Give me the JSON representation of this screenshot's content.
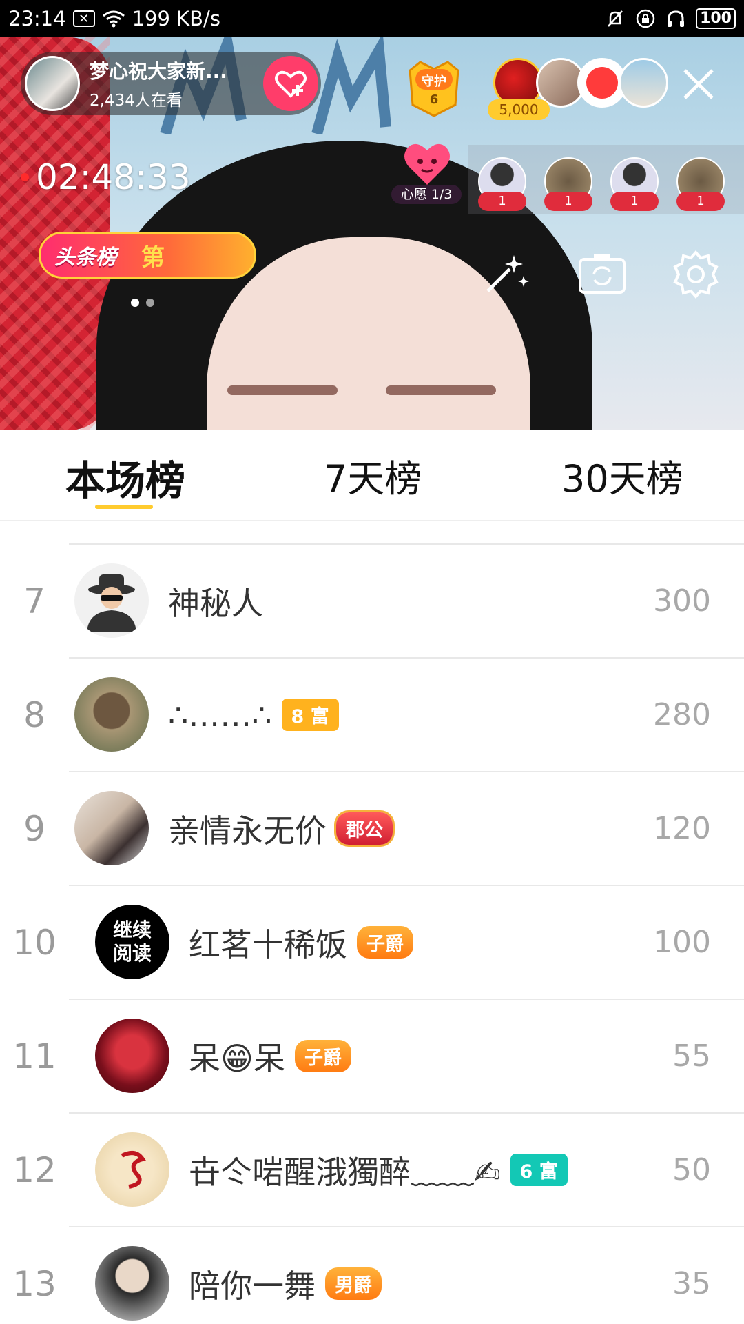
{
  "status_bar": {
    "time": "23:14",
    "speed": "199 KB/s",
    "battery": "100",
    "icons": [
      "notification-x-icon",
      "wifi-icon",
      "bell-muted-icon",
      "lock-rotation-icon",
      "headphones-icon",
      "battery-icon"
    ]
  },
  "live": {
    "anchor_name": "梦心祝大家新...",
    "viewers": "2,434人在看",
    "guard_label": "守护",
    "guard_count": "6",
    "top_viewer_score": "5,000",
    "timer": "02:48:33",
    "wish_label": "心愿 1/3",
    "gift_counts": [
      "1",
      "1",
      "1",
      "1"
    ],
    "headline_title": "头条榜",
    "headline_rank": "第",
    "page_dots": 2,
    "current_page": 1
  },
  "tabs": [
    {
      "label": "本场榜",
      "active": true
    },
    {
      "label": "7天榜",
      "active": false
    },
    {
      "label": "30天榜",
      "active": false
    }
  ],
  "ranking": [
    {
      "rank": "7",
      "name": "神秘人",
      "tag": "",
      "score": "300"
    },
    {
      "rank": "8",
      "name": "∴……∴",
      "tag": "8 富",
      "score": "280"
    },
    {
      "rank": "9",
      "name": "亲情永无价",
      "tag": "郡公",
      "score": "120"
    },
    {
      "rank": "10",
      "name": "红茗十稀饭",
      "tag": "子爵",
      "score": "100"
    },
    {
      "rank": "11",
      "name": "呆😁呆",
      "tag": "子爵",
      "score": "55"
    },
    {
      "rank": "12",
      "name": "卋仒啱醒涐獨醉﹏﹏✍",
      "tag": "6 富",
      "score": "50"
    },
    {
      "rank": "13",
      "name": "陪你一舞",
      "tag": "男爵",
      "score": "35"
    }
  ],
  "avatar_texts": {
    "row10": "继续\n阅读"
  },
  "colors": {
    "accent": "#ffcb2e",
    "follow": "#ff3d6a",
    "rich_orange": "#ffb21e",
    "rich_teal": "#13c8b5"
  }
}
